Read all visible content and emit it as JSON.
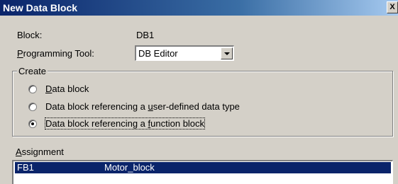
{
  "window": {
    "title": "New Data Block",
    "close_glyph": "X"
  },
  "block": {
    "label": "Block:",
    "value": "DB1"
  },
  "programming_tool": {
    "label_underlined": "P",
    "label_rest": "rogramming Tool:",
    "selected": "DB Editor"
  },
  "create_group": {
    "legend": "Create",
    "options": [
      {
        "pre": "",
        "ul": "D",
        "post": "ata block",
        "checked": false
      },
      {
        "pre": "Data block referencing a ",
        "ul": "u",
        "post": "ser-defined data type",
        "checked": false
      },
      {
        "pre": "Data block referencing a ",
        "ul": "f",
        "post": "unction block",
        "checked": true
      }
    ]
  },
  "assignment": {
    "label_underlined": "A",
    "label_rest": "ssignment",
    "rows": [
      {
        "col1": "FB1",
        "col2": "Motor_block",
        "selected": true
      }
    ]
  }
}
